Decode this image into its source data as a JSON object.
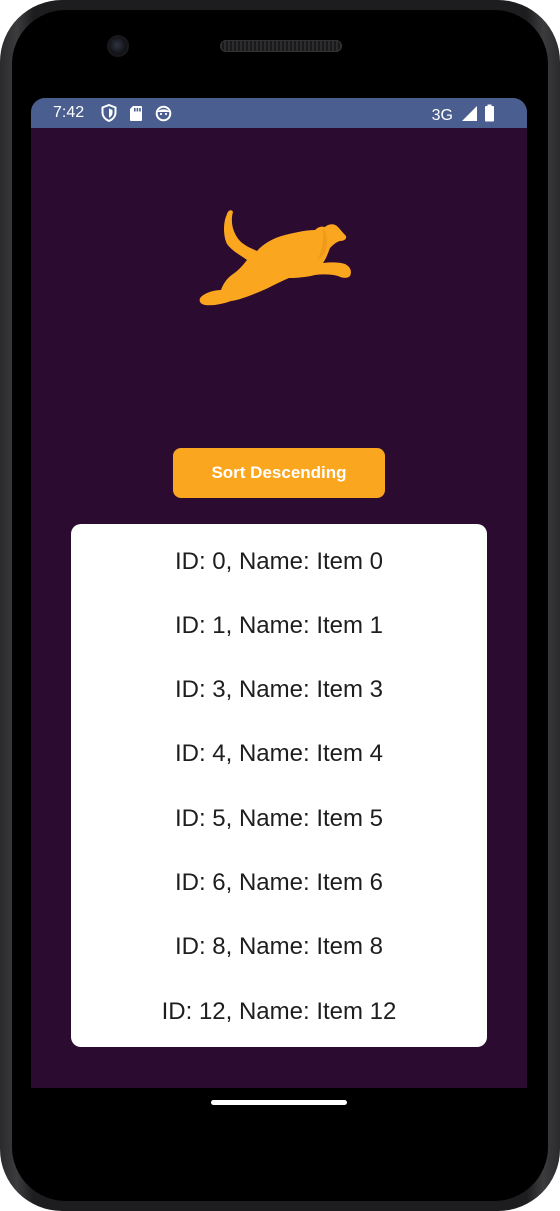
{
  "status_bar": {
    "time": "7:42",
    "left_icons": [
      "shield-icon",
      "sd-card-icon",
      "face-icon"
    ],
    "network": "3G",
    "right_icons": [
      "signal-icon",
      "battery-icon"
    ],
    "background_color": "#4a5f90"
  },
  "app": {
    "background_color": "#2b0b30",
    "logo_icon": "running-dog-icon",
    "accent_color": "#fba61f",
    "sort_button_label": "Sort Descending",
    "items": [
      "ID: 0, Name: Item 0",
      "ID: 1, Name: Item 1",
      "ID: 3, Name: Item 3",
      "ID: 4, Name: Item 4",
      "ID: 5, Name: Item 5",
      "ID: 6, Name: Item 6",
      "ID: 8, Name: Item 8",
      "ID: 12, Name: Item 12"
    ]
  }
}
